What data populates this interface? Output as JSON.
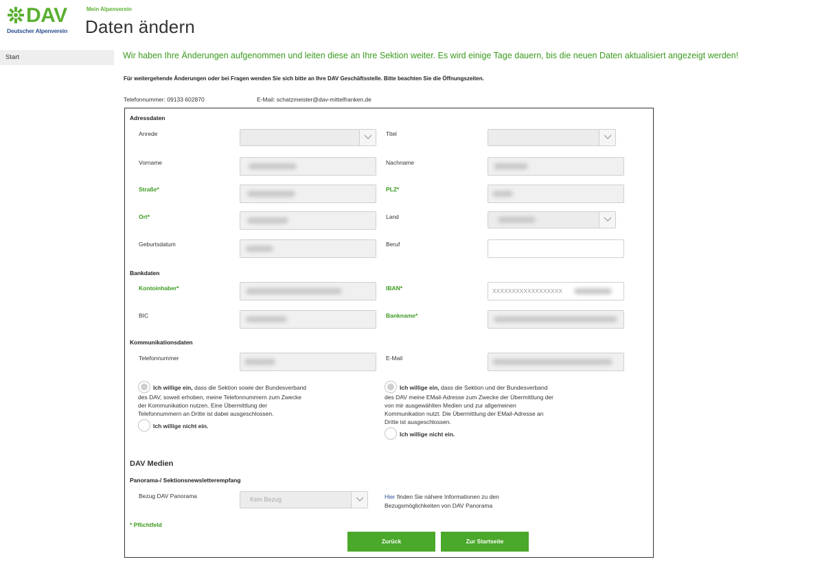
{
  "header": {
    "logo_text": "DAV",
    "logo_subtitle": "Deutscher Alpenverein",
    "kicker": "Mein Alpenverein",
    "title": "Daten ändern"
  },
  "sidebar": {
    "items": [
      {
        "label": "Start"
      }
    ]
  },
  "messages": {
    "success": "Wir haben Ihre Änderungen aufgenommen und leiten diese an Ihre Sektion weiter. Es wird einige Tage dauern, bis die neuen Daten aktualisiert angezeigt werden!",
    "note": "Für weitergehende Änderungen oder bei Fragen wenden Sie sich bitte an Ihre DAV Geschäftsstelle. Bitte beachten Sie die Öffnungszeiten.",
    "phone": "Telefonnummer: 09133 602870",
    "email": "E-Mail: schatzmeister@dav-mittelfranken.de"
  },
  "form": {
    "address": {
      "heading": "Adressdaten",
      "anrede_label": "Anrede",
      "titel_label": "Titel",
      "vorname_label": "Vorname",
      "nachname_label": "Nachname",
      "strasse_label": "Straße*",
      "plz_label": "PLZ*",
      "ort_label": "Ort*",
      "land_label": "Land",
      "geburtsdatum_label": "Geburtsdatum",
      "beruf_label": "Beruf"
    },
    "bank": {
      "heading": "Bankdaten",
      "kontoinhaber_label": "Kontoinhaber*",
      "iban_label": "IBAN*",
      "iban_value": "XXXXXXXXXXXXXXXXXX",
      "bic_label": "BIC",
      "bankname_label": "Bankname*"
    },
    "communication": {
      "heading": "Kommunikationsdaten",
      "telefon_label": "Telefonnummer",
      "email_label": "E-Mail",
      "phone_consent_yes_bold": "Ich willige ein,",
      "phone_consent_yes_text": "dass die Sektion sowie der Bundesverband",
      "phone_consent_line2": "des DAV, soweit erhoben, meine Telefonnummern zum Zwecke",
      "phone_consent_line3": "der Kommunikation nutzen. Eine Übermittlung der",
      "phone_consent_line4": "Telefonnummern an Dritte ist dabei ausgeschlossen.",
      "phone_consent_no": "Ich willige nicht ein.",
      "email_consent_yes_bold": "Ich willige ein,",
      "email_consent_yes_text": "dass die Sektion und der Bundesverband",
      "email_consent_line2": "des DAV meine EMail-Adresse zum Zwecke der Übermittlung der",
      "email_consent_line3": "von mir ausgewählten Medien und zur allgemeinen",
      "email_consent_line4": "Kommunikation nutzt. Die Übermittlung der EMail-Adresse an",
      "email_consent_line5": "Dritte ist ausgeschlossen.",
      "email_consent_no": "Ich willige nicht ein."
    },
    "media": {
      "heading": "DAV Medien",
      "subheading": "Panorama-/ Sektionsnewsletterempfang",
      "bezug_label": "Bezug DAV Panorama",
      "bezug_value": "Kein Bezug",
      "info_link": "Hier",
      "info_text": "finden Sie nähere Informationen zu den",
      "info_line2": "Bezugsmöglichkeiten von DAV Panorama"
    },
    "required_note": "* Pflichtfeld",
    "back_button": "Zurück",
    "home_button": "Zur Startseite"
  },
  "colors": {
    "brand_green": "#4aa82a",
    "text_green": "#3a9a1e",
    "logo_blue": "#2b4f8f"
  }
}
